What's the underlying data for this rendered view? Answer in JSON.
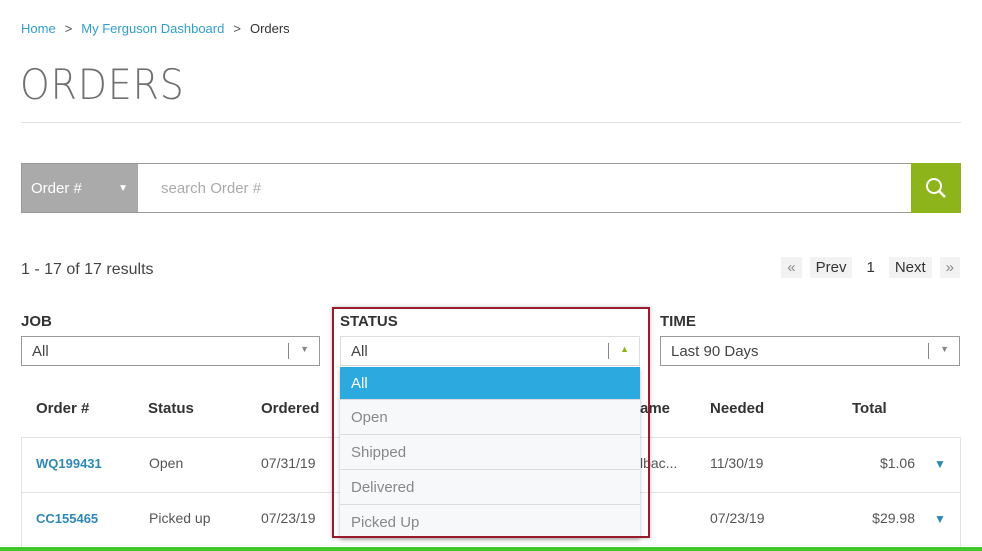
{
  "breadcrumb": [
    "Home",
    "My Ferguson Dashboard",
    "Orders"
  ],
  "page_title": "ORDERS",
  "search": {
    "type_label": "Order #",
    "placeholder": "search Order #",
    "icon": "search-icon"
  },
  "results_text": "1 - 17 of 17 results",
  "pagination": {
    "first": "«",
    "prev": "Prev",
    "page": "1",
    "next": "Next",
    "last": "»"
  },
  "filters": {
    "job": {
      "label": "JOB",
      "value": "All"
    },
    "status": {
      "label": "STATUS",
      "value": "All",
      "options": [
        "All",
        "Open",
        "Shipped",
        "Delivered",
        "Picked Up"
      ]
    },
    "time": {
      "label": "TIME",
      "value": "Last 90 Days"
    }
  },
  "table": {
    "headers": [
      "Order #",
      "Status",
      "Ordered",
      "ame",
      "Needed",
      "Total"
    ],
    "rows": [
      {
        "order": "WQ199431",
        "status": "Open",
        "ordered": "07/31/19",
        "name": "lbac...",
        "needed": "11/30/19",
        "total": "$1.06"
      },
      {
        "order": "CC155465",
        "status": "Picked up",
        "ordered": "07/23/19",
        "name": "",
        "needed": "07/23/19",
        "total": "$29.98"
      }
    ]
  },
  "colors": {
    "accent": "#2ca9df",
    "search_button": "#8db51b",
    "link": "#2f9fd0",
    "highlight_border": "#9a1b2b"
  }
}
